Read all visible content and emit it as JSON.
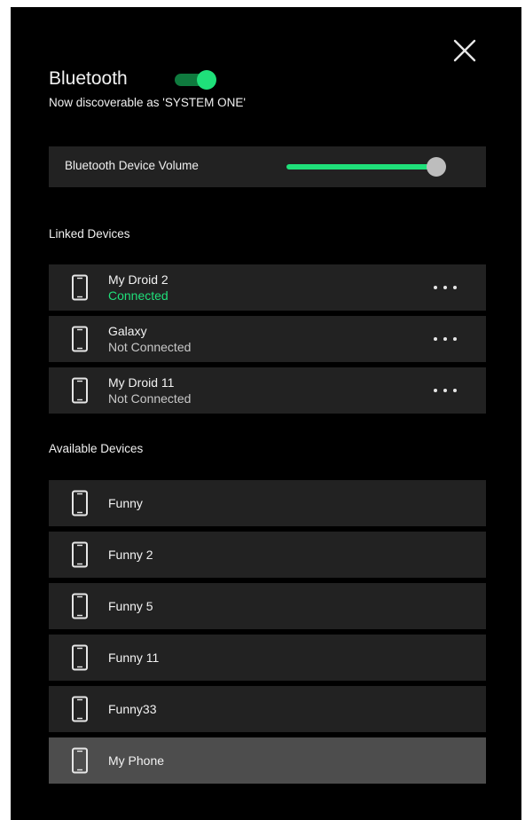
{
  "colors": {
    "accent": "#1fe07a",
    "panel_bg": "#000000",
    "row_bg": "#222222",
    "row_selected_bg": "#4d4d4d",
    "connected": "#1fe07a",
    "not_connected": "#c8c8c8"
  },
  "header": {
    "title": "Bluetooth",
    "bluetooth_enabled": true,
    "subtitle": "Now discoverable as 'SYSTEM ONE'",
    "close_icon": "close-icon"
  },
  "volume": {
    "label": "Bluetooth Device Volume",
    "level": 0.92
  },
  "linked": {
    "label": "Linked Devices",
    "devices": [
      {
        "name": "My Droid 2",
        "status": "Connected",
        "connected": true,
        "icon": "phone-icon"
      },
      {
        "name": "Galaxy",
        "status": "Not Connected",
        "connected": false,
        "icon": "phone-icon"
      },
      {
        "name": "My Droid 11",
        "status": "Not Connected",
        "connected": false,
        "icon": "phone-icon"
      }
    ]
  },
  "available": {
    "label": "Available Devices",
    "devices": [
      {
        "name": "Funny",
        "selected": false,
        "icon": "phone-icon"
      },
      {
        "name": "Funny 2",
        "selected": false,
        "icon": "phone-icon"
      },
      {
        "name": "Funny 5",
        "selected": false,
        "icon": "phone-icon"
      },
      {
        "name": "Funny 11",
        "selected": false,
        "icon": "phone-icon"
      },
      {
        "name": "Funny33",
        "selected": false,
        "icon": "phone-icon"
      },
      {
        "name": "My Phone",
        "selected": true,
        "icon": "phone-icon"
      }
    ]
  }
}
